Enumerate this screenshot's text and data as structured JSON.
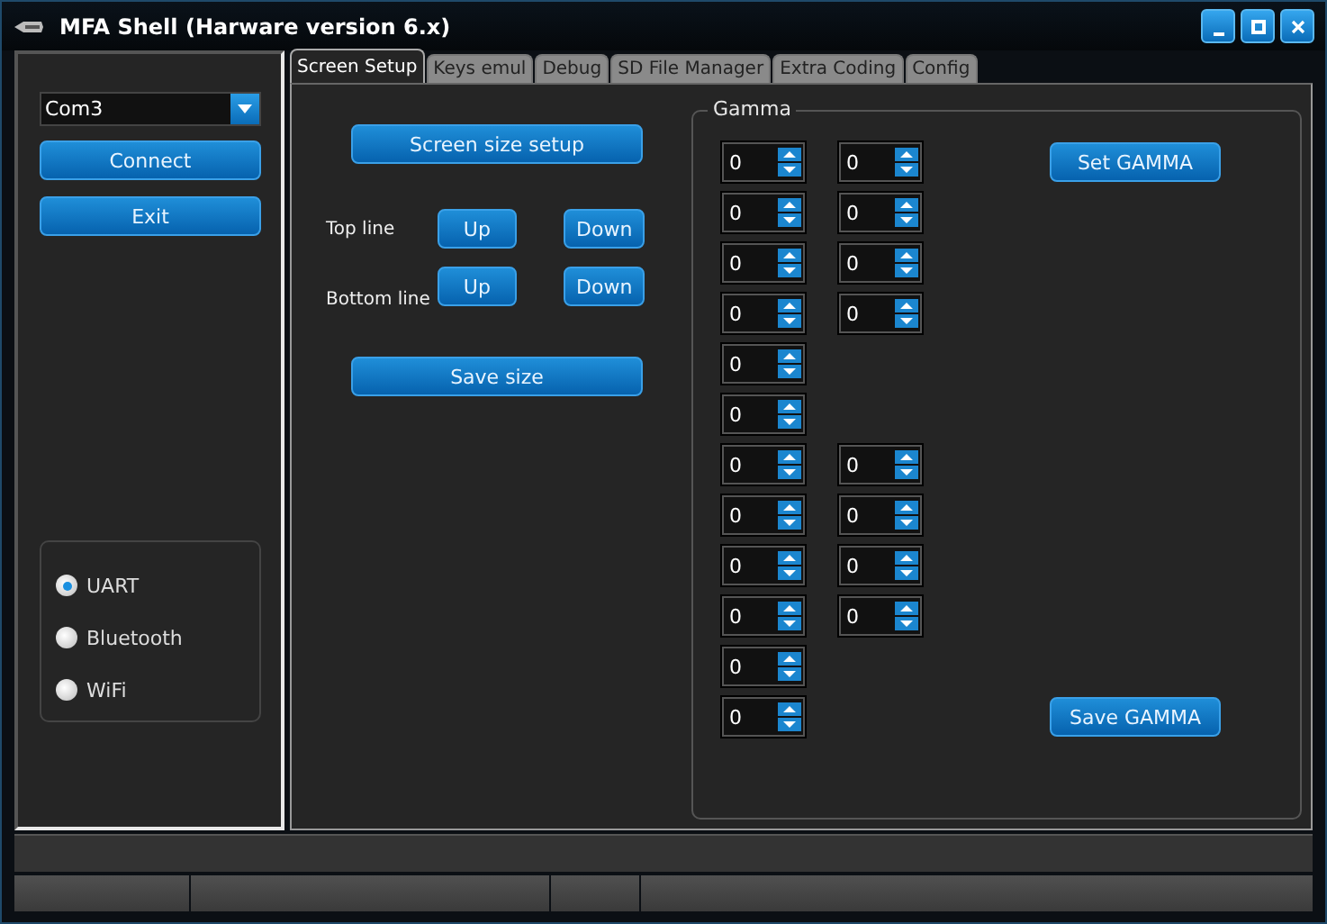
{
  "window": {
    "title": "MFA Shell (Harware version 6.x)"
  },
  "sidebar": {
    "port": "Com3",
    "buttons": [
      "Connect",
      "Exit"
    ],
    "connections": [
      {
        "label": "UART",
        "selected": true
      },
      {
        "label": "Bluetooth",
        "selected": false
      },
      {
        "label": "WiFi",
        "selected": false
      }
    ]
  },
  "tabs": [
    {
      "label": "Screen Setup",
      "selected": true
    },
    {
      "label": "Keys emul",
      "selected": false
    },
    {
      "label": "Debug",
      "selected": false
    },
    {
      "label": "SD File Manager",
      "selected": false
    },
    {
      "label": "Extra Coding",
      "selected": false
    },
    {
      "label": "Config",
      "selected": false
    }
  ],
  "screen_setup": {
    "size_button": "Screen size setup",
    "lines": [
      {
        "label": "Top line",
        "up": "Up",
        "down": "Down"
      },
      {
        "label": "Bottom line",
        "up": "Up",
        "down": "Down"
      }
    ],
    "save_button": "Save size"
  },
  "gamma": {
    "title": "Gamma",
    "set_button": "Set GAMMA",
    "save_button": "Save GAMMA",
    "rows": [
      [
        "0",
        "0"
      ],
      [
        "0",
        "0"
      ],
      [
        "0",
        "0"
      ],
      [
        "0",
        "0"
      ],
      [
        "0"
      ],
      [
        "0"
      ],
      [
        "0",
        "0"
      ],
      [
        "0",
        "0"
      ],
      [
        "0",
        "0"
      ],
      [
        "0",
        "0"
      ],
      [
        "0"
      ],
      [
        "0"
      ]
    ]
  }
}
